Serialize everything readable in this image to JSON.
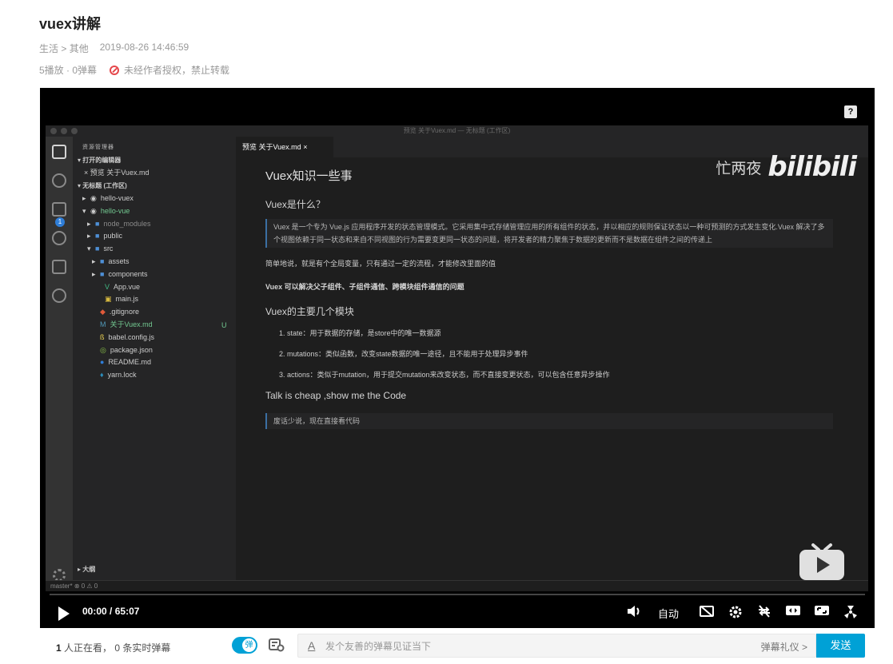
{
  "video": {
    "title": "vuex讲解",
    "category": "生活",
    "subcategory": "其他",
    "category_separator": ">",
    "publish_time": "2019-08-26 14:46:59",
    "stats": "5播放 · 0弹幕",
    "copyright_notice": "未经作者授权，禁止转载"
  },
  "screen": {
    "window_title": "预览 关于Vuex.md — 无标题 (工作区)",
    "sidebar": {
      "header": "资源管理器",
      "open_editors": "打开的编辑器",
      "open_file": "预览 关于Vuex.md",
      "workspace": "无标题 (工作区)",
      "tree": [
        {
          "label": "hello-vuex",
          "icon": "circle",
          "color": "#cccccc"
        },
        {
          "label": "hello-vue",
          "icon": "circle",
          "color": "#73c991"
        },
        {
          "label": "node_modules",
          "icon": "folder",
          "color": "#8a8a8a"
        },
        {
          "label": "public",
          "icon": "folder",
          "color": "#cccccc"
        },
        {
          "label": "src",
          "icon": "folder",
          "color": "#cccccc"
        },
        {
          "label": "assets",
          "icon": "folder",
          "color": "#cccccc"
        },
        {
          "label": "components",
          "icon": "folder",
          "color": "#cccccc"
        },
        {
          "label": "App.vue",
          "icon": "vue",
          "color": "#cccccc"
        },
        {
          "label": "main.js",
          "icon": "js",
          "color": "#cccccc"
        },
        {
          "label": ".gitignore",
          "icon": "git",
          "color": "#cccccc"
        },
        {
          "label": "关于Vuex.md",
          "icon": "md",
          "color": "#73c991"
        },
        {
          "label": "babel.config.js",
          "icon": "babel",
          "color": "#cccccc"
        },
        {
          "label": "package.json",
          "icon": "json",
          "color": "#cccccc"
        },
        {
          "label": "README.md",
          "icon": "info",
          "color": "#cccccc"
        },
        {
          "label": "yarn.lock",
          "icon": "yarn",
          "color": "#cccccc"
        }
      ],
      "modified_marker": "U",
      "outline": "大纲"
    },
    "activity_badge": "1",
    "status_bar": "master*  ⊗ 0 ⚠ 0",
    "tab_label": "预览 关于Vuex.md",
    "tab_close": "×",
    "watermark_name": "忙两夜",
    "watermark_logo": "bilibili",
    "doc": {
      "h1": "Vuex知识一些事",
      "q1": "Vuex是什么？",
      "quote1": "Vuex 是一个专为 Vue.js 应用程序开发的状态管理模式。它采用集中式存储管理应用的所有组件的状态，并以相应的规则保证状态以一种可预测的方式发生变化.Vuex 解决了多个视图依赖于同一状态和来自不同视图的行为需要变更同一状态的问题，将开发者的精力聚焦于数据的更新而不是数据在组件之间的传递上",
      "p1": "简单地说，就是有个全局变量，只有通过一定的流程，才能修改里面的值",
      "p2": "Vuex 可以解决父子组件、子组件通信、跨模块组件通信的问题",
      "h3": "Vuex的主要几个模块",
      "list": [
        "1. state：用于数据的存储，是store中的唯一数据源",
        "2. mutations：类似函数，改变state数据的唯一途径，且不能用于处理异步事件",
        "3. actions：类似于mutation，用于提交mutation来改变状态，而不直接变更状态，可以包含任意异步操作"
      ],
      "h3b": "Talk is cheap ,show me the Code",
      "quote2": "废话少说，现在直接看代码"
    }
  },
  "player": {
    "help": "?",
    "current_time": "00:00",
    "time_sep": "/",
    "duration": "65:07",
    "progress": 0.0,
    "quality": "自动"
  },
  "bottom": {
    "viewers_count": "1",
    "viewers_text": "人正在看，",
    "danmaku_count": "0",
    "danmaku_text": "条实时弹幕",
    "toggle_label": "弹",
    "danmaku_placeholder": "发个友善的弹幕见证当下",
    "etiquette": "弹幕礼仪 >",
    "send": "发送"
  },
  "colors": {
    "accent": "#00a1d6",
    "warning": "#e5474b",
    "git_new": "#73c991"
  }
}
